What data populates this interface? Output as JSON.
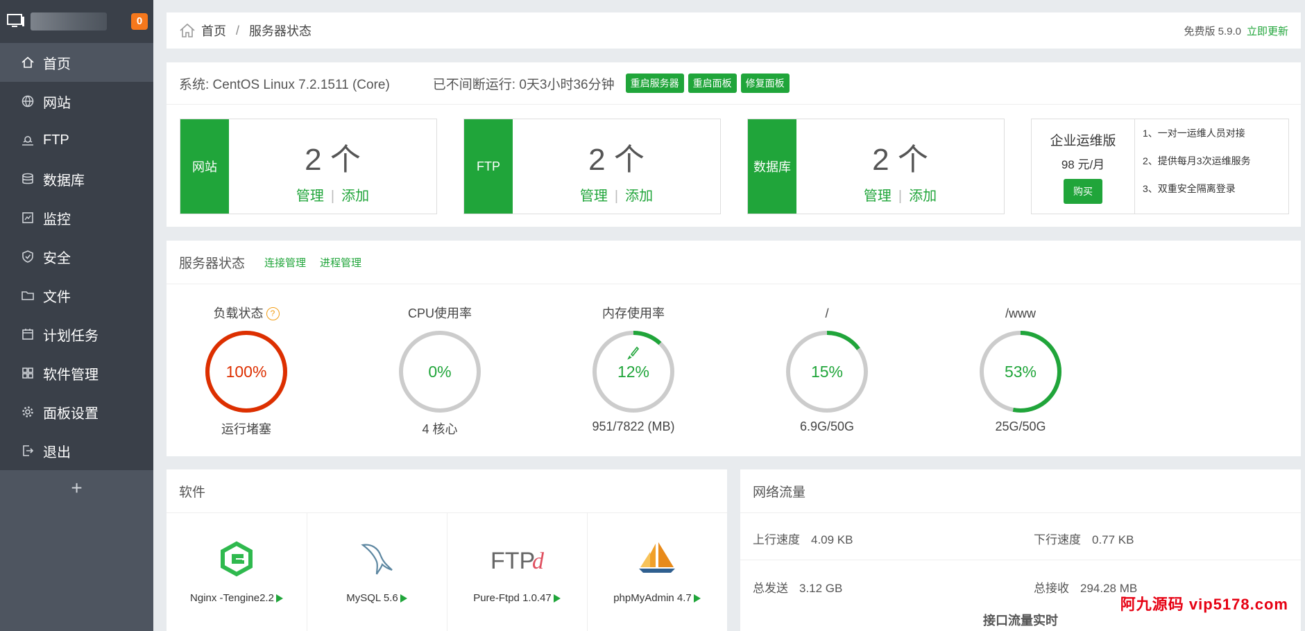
{
  "sidebar": {
    "badge": "0",
    "items": [
      {
        "label": "首页",
        "icon": "home-icon",
        "active": true
      },
      {
        "label": "网站",
        "icon": "globe-icon"
      },
      {
        "label": "FTP",
        "icon": "ftp-icon"
      },
      {
        "label": "数据库",
        "icon": "database-icon"
      },
      {
        "label": "监控",
        "icon": "monitor-icon"
      },
      {
        "label": "安全",
        "icon": "shield-icon"
      },
      {
        "label": "文件",
        "icon": "folder-icon"
      },
      {
        "label": "计划任务",
        "icon": "calendar-icon"
      },
      {
        "label": "软件管理",
        "icon": "apps-icon"
      },
      {
        "label": "面板设置",
        "icon": "gear-icon"
      },
      {
        "label": "退出",
        "icon": "logout-icon"
      }
    ],
    "add": "+"
  },
  "topbar": {
    "home": "首页",
    "sep": "/",
    "current": "服务器状态",
    "version": "免费版 5.9.0",
    "update": "立即更新"
  },
  "system": {
    "os": "系统: CentOS Linux 7.2.1511 (Core)",
    "uptime": "已不间断运行: 0天3小时36分钟",
    "btn_restart_server": "重启服务器",
    "btn_restart_panel": "重启面板",
    "btn_repair_panel": "修复面板"
  },
  "cards": [
    {
      "label": "网站",
      "count": "2 个",
      "manage": "管理",
      "add": "添加"
    },
    {
      "label": "FTP",
      "count": "2 个",
      "manage": "管理",
      "add": "添加"
    },
    {
      "label": "数据库",
      "count": "2 个",
      "manage": "管理",
      "add": "添加"
    }
  ],
  "enterprise": {
    "title": "企业运维版",
    "price": "98 元/月",
    "buy": "购买",
    "features": [
      "1、一对一运维人员对接",
      "2、提供每月3次运维服务",
      "3、双重安全隔离登录"
    ]
  },
  "status": {
    "title": "服务器状态",
    "link_conn": "连接管理",
    "link_proc": "进程管理",
    "help": "?",
    "gauges": [
      {
        "title": "负载状态",
        "value": "100%",
        "percent": 100,
        "sub": "运行堵塞",
        "color": "#dd2f00"
      },
      {
        "title": "CPU使用率",
        "value": "0%",
        "percent": 0,
        "sub": "4 核心",
        "color": "#20a53a"
      },
      {
        "title": "内存使用率",
        "value": "12%",
        "percent": 12,
        "sub": "951/7822 (MB)",
        "color": "#20a53a"
      },
      {
        "title": "/",
        "value": "15%",
        "percent": 15,
        "sub": "6.9G/50G",
        "color": "#20a53a"
      },
      {
        "title": "/www",
        "value": "53%",
        "percent": 53,
        "sub": "25G/50G",
        "color": "#20a53a"
      }
    ]
  },
  "software": {
    "title": "软件",
    "items": [
      {
        "name": "Nginx -Tengine2.2",
        "icon": "nginx-icon"
      },
      {
        "name": "MySQL 5.6",
        "icon": "mysql-dolphin-icon"
      },
      {
        "name": "Pure-Ftpd 1.0.47",
        "icon": "ftpd-icon"
      },
      {
        "name": "phpMyAdmin 4.7",
        "icon": "phpmyadmin-sailboat-icon"
      }
    ]
  },
  "network": {
    "title": "网络流量",
    "up_label": "上行速度",
    "up_value": "4.09 KB",
    "down_label": "下行速度",
    "down_value": "0.77 KB",
    "sent_label": "总发送",
    "sent_value": "3.12 GB",
    "recv_label": "总接收",
    "recv_value": "294.28 MB",
    "chart_title": "接口流量实时"
  },
  "watermark": "阿九源码 vip5178.com"
}
